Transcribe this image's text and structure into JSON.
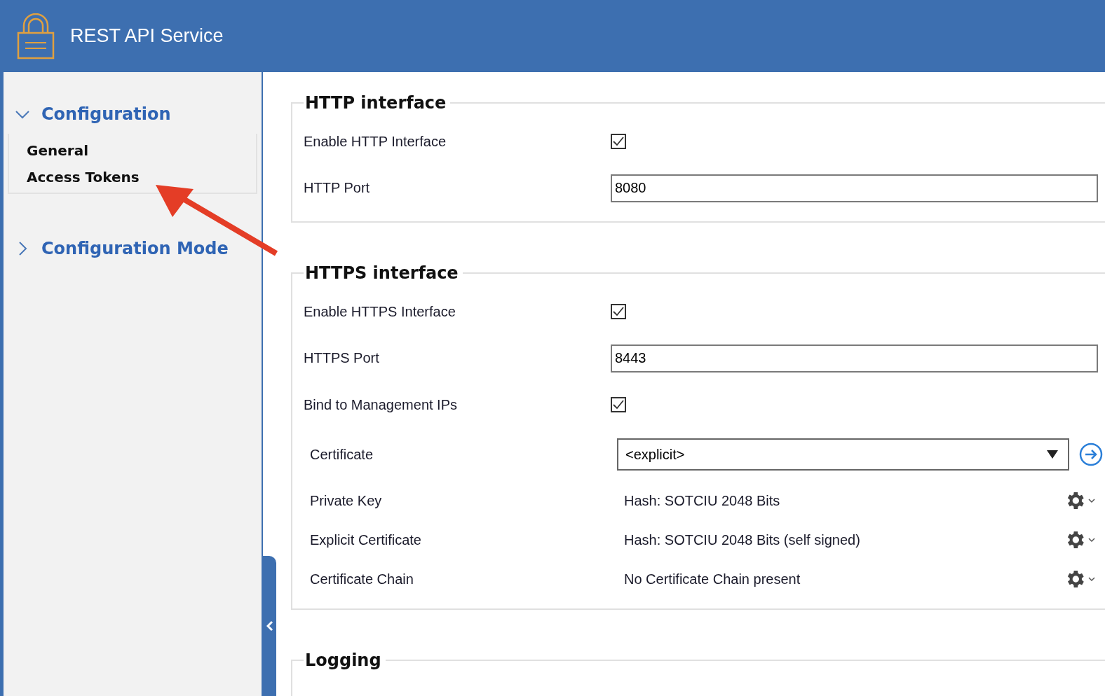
{
  "window": {
    "title": "REST API Service"
  },
  "sidebar": {
    "sections": [
      {
        "title": "Configuration",
        "expanded": true,
        "items": [
          {
            "label": "General"
          },
          {
            "label": "Access Tokens"
          }
        ]
      },
      {
        "title": "Configuration Mode",
        "expanded": false
      }
    ]
  },
  "groups": [
    {
      "title": "HTTP interface",
      "rows": [
        {
          "kind": "checkbox",
          "label": "Enable HTTP Interface",
          "checked": true
        },
        {
          "kind": "text_input",
          "label": "HTTP Port",
          "value": "8080"
        }
      ]
    },
    {
      "title": "HTTPS interface",
      "rows": [
        {
          "kind": "checkbox",
          "label": "Enable HTTPS Interface",
          "checked": true
        },
        {
          "kind": "text_input",
          "label": "HTTPS Port",
          "value": "8443"
        },
        {
          "kind": "checkbox",
          "label": "Bind to Management IPs",
          "checked": true
        },
        {
          "kind": "dropdown",
          "label": "Certificate",
          "value": "<explicit>"
        },
        {
          "kind": "info",
          "label": "Private Key",
          "value": "Hash: SOTCIU 2048 Bits"
        },
        {
          "kind": "info",
          "label": "Explicit Certificate",
          "value": "Hash: SOTCIU 2048 Bits (self signed)"
        },
        {
          "kind": "info",
          "label": "Certificate Chain",
          "value": "No Certificate Chain present"
        }
      ]
    },
    {
      "title": "Logging"
    }
  ]
}
